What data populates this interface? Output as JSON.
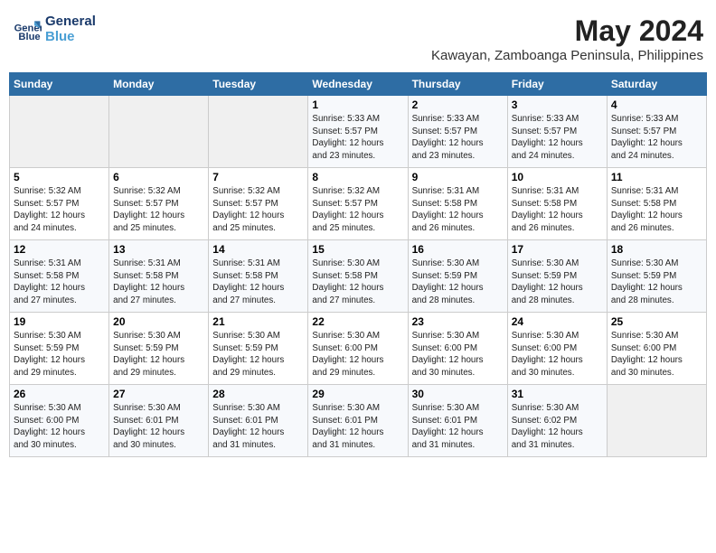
{
  "header": {
    "logo_line1": "General",
    "logo_line2": "Blue",
    "month_year": "May 2024",
    "location": "Kawayan, Zamboanga Peninsula, Philippines"
  },
  "days_of_week": [
    "Sunday",
    "Monday",
    "Tuesday",
    "Wednesday",
    "Thursday",
    "Friday",
    "Saturday"
  ],
  "weeks": [
    [
      {
        "num": "",
        "info": ""
      },
      {
        "num": "",
        "info": ""
      },
      {
        "num": "",
        "info": ""
      },
      {
        "num": "1",
        "info": "Sunrise: 5:33 AM\nSunset: 5:57 PM\nDaylight: 12 hours\nand 23 minutes."
      },
      {
        "num": "2",
        "info": "Sunrise: 5:33 AM\nSunset: 5:57 PM\nDaylight: 12 hours\nand 23 minutes."
      },
      {
        "num": "3",
        "info": "Sunrise: 5:33 AM\nSunset: 5:57 PM\nDaylight: 12 hours\nand 24 minutes."
      },
      {
        "num": "4",
        "info": "Sunrise: 5:33 AM\nSunset: 5:57 PM\nDaylight: 12 hours\nand 24 minutes."
      }
    ],
    [
      {
        "num": "5",
        "info": "Sunrise: 5:32 AM\nSunset: 5:57 PM\nDaylight: 12 hours\nand 24 minutes."
      },
      {
        "num": "6",
        "info": "Sunrise: 5:32 AM\nSunset: 5:57 PM\nDaylight: 12 hours\nand 25 minutes."
      },
      {
        "num": "7",
        "info": "Sunrise: 5:32 AM\nSunset: 5:57 PM\nDaylight: 12 hours\nand 25 minutes."
      },
      {
        "num": "8",
        "info": "Sunrise: 5:32 AM\nSunset: 5:57 PM\nDaylight: 12 hours\nand 25 minutes."
      },
      {
        "num": "9",
        "info": "Sunrise: 5:31 AM\nSunset: 5:58 PM\nDaylight: 12 hours\nand 26 minutes."
      },
      {
        "num": "10",
        "info": "Sunrise: 5:31 AM\nSunset: 5:58 PM\nDaylight: 12 hours\nand 26 minutes."
      },
      {
        "num": "11",
        "info": "Sunrise: 5:31 AM\nSunset: 5:58 PM\nDaylight: 12 hours\nand 26 minutes."
      }
    ],
    [
      {
        "num": "12",
        "info": "Sunrise: 5:31 AM\nSunset: 5:58 PM\nDaylight: 12 hours\nand 27 minutes."
      },
      {
        "num": "13",
        "info": "Sunrise: 5:31 AM\nSunset: 5:58 PM\nDaylight: 12 hours\nand 27 minutes."
      },
      {
        "num": "14",
        "info": "Sunrise: 5:31 AM\nSunset: 5:58 PM\nDaylight: 12 hours\nand 27 minutes."
      },
      {
        "num": "15",
        "info": "Sunrise: 5:30 AM\nSunset: 5:58 PM\nDaylight: 12 hours\nand 27 minutes."
      },
      {
        "num": "16",
        "info": "Sunrise: 5:30 AM\nSunset: 5:59 PM\nDaylight: 12 hours\nand 28 minutes."
      },
      {
        "num": "17",
        "info": "Sunrise: 5:30 AM\nSunset: 5:59 PM\nDaylight: 12 hours\nand 28 minutes."
      },
      {
        "num": "18",
        "info": "Sunrise: 5:30 AM\nSunset: 5:59 PM\nDaylight: 12 hours\nand 28 minutes."
      }
    ],
    [
      {
        "num": "19",
        "info": "Sunrise: 5:30 AM\nSunset: 5:59 PM\nDaylight: 12 hours\nand 29 minutes."
      },
      {
        "num": "20",
        "info": "Sunrise: 5:30 AM\nSunset: 5:59 PM\nDaylight: 12 hours\nand 29 minutes."
      },
      {
        "num": "21",
        "info": "Sunrise: 5:30 AM\nSunset: 5:59 PM\nDaylight: 12 hours\nand 29 minutes."
      },
      {
        "num": "22",
        "info": "Sunrise: 5:30 AM\nSunset: 6:00 PM\nDaylight: 12 hours\nand 29 minutes."
      },
      {
        "num": "23",
        "info": "Sunrise: 5:30 AM\nSunset: 6:00 PM\nDaylight: 12 hours\nand 30 minutes."
      },
      {
        "num": "24",
        "info": "Sunrise: 5:30 AM\nSunset: 6:00 PM\nDaylight: 12 hours\nand 30 minutes."
      },
      {
        "num": "25",
        "info": "Sunrise: 5:30 AM\nSunset: 6:00 PM\nDaylight: 12 hours\nand 30 minutes."
      }
    ],
    [
      {
        "num": "26",
        "info": "Sunrise: 5:30 AM\nSunset: 6:00 PM\nDaylight: 12 hours\nand 30 minutes."
      },
      {
        "num": "27",
        "info": "Sunrise: 5:30 AM\nSunset: 6:01 PM\nDaylight: 12 hours\nand 30 minutes."
      },
      {
        "num": "28",
        "info": "Sunrise: 5:30 AM\nSunset: 6:01 PM\nDaylight: 12 hours\nand 31 minutes."
      },
      {
        "num": "29",
        "info": "Sunrise: 5:30 AM\nSunset: 6:01 PM\nDaylight: 12 hours\nand 31 minutes."
      },
      {
        "num": "30",
        "info": "Sunrise: 5:30 AM\nSunset: 6:01 PM\nDaylight: 12 hours\nand 31 minutes."
      },
      {
        "num": "31",
        "info": "Sunrise: 5:30 AM\nSunset: 6:02 PM\nDaylight: 12 hours\nand 31 minutes."
      },
      {
        "num": "",
        "info": ""
      }
    ]
  ]
}
